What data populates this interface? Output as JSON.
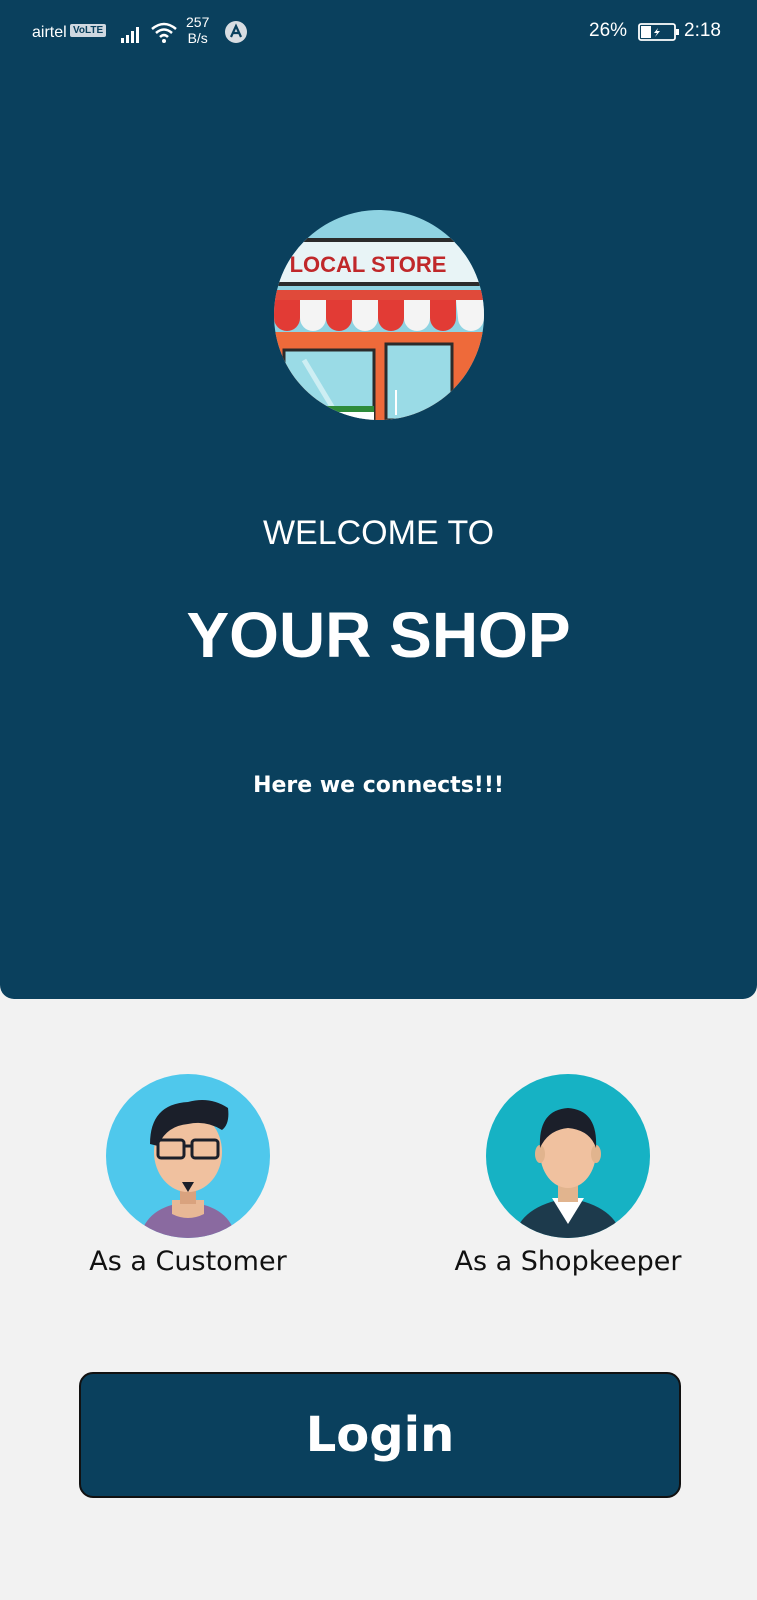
{
  "status_bar": {
    "carrier": "airtel",
    "volte": "VoLTE",
    "net_speed_value": "257",
    "net_speed_unit": "B/s",
    "battery_percent": "26%",
    "time": "2:18"
  },
  "hero": {
    "logo_text": "LOCAL STORE",
    "welcome": "WELCOME TO",
    "title": "YOUR SHOP",
    "tagline": "Here we connects!!!"
  },
  "roles": {
    "customer_label": "As a Customer",
    "shopkeeper_label": "As a Shopkeeper"
  },
  "login_label": "Login",
  "colors": {
    "primary": "#0a405d",
    "background": "#f2f2f2",
    "customer_avatar_bg": "#4fc8ec",
    "shopkeeper_avatar_bg": "#16b2c4"
  }
}
